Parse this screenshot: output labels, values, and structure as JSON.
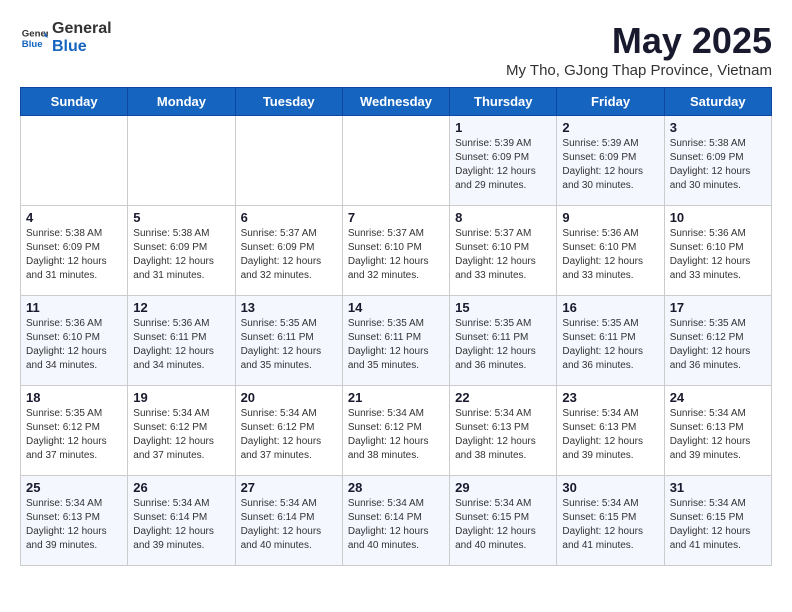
{
  "header": {
    "logo_general": "General",
    "logo_blue": "Blue",
    "title": "May 2025",
    "subtitle": "My Tho, GJong Thap Province, Vietnam"
  },
  "weekdays": [
    "Sunday",
    "Monday",
    "Tuesday",
    "Wednesday",
    "Thursday",
    "Friday",
    "Saturday"
  ],
  "weeks": [
    [
      {
        "day": "",
        "info": ""
      },
      {
        "day": "",
        "info": ""
      },
      {
        "day": "",
        "info": ""
      },
      {
        "day": "",
        "info": ""
      },
      {
        "day": "1",
        "info": "Sunrise: 5:39 AM\nSunset: 6:09 PM\nDaylight: 12 hours and 29 minutes."
      },
      {
        "day": "2",
        "info": "Sunrise: 5:39 AM\nSunset: 6:09 PM\nDaylight: 12 hours and 30 minutes."
      },
      {
        "day": "3",
        "info": "Sunrise: 5:38 AM\nSunset: 6:09 PM\nDaylight: 12 hours and 30 minutes."
      }
    ],
    [
      {
        "day": "4",
        "info": "Sunrise: 5:38 AM\nSunset: 6:09 PM\nDaylight: 12 hours and 31 minutes."
      },
      {
        "day": "5",
        "info": "Sunrise: 5:38 AM\nSunset: 6:09 PM\nDaylight: 12 hours and 31 minutes."
      },
      {
        "day": "6",
        "info": "Sunrise: 5:37 AM\nSunset: 6:09 PM\nDaylight: 12 hours and 32 minutes."
      },
      {
        "day": "7",
        "info": "Sunrise: 5:37 AM\nSunset: 6:10 PM\nDaylight: 12 hours and 32 minutes."
      },
      {
        "day": "8",
        "info": "Sunrise: 5:37 AM\nSunset: 6:10 PM\nDaylight: 12 hours and 33 minutes."
      },
      {
        "day": "9",
        "info": "Sunrise: 5:36 AM\nSunset: 6:10 PM\nDaylight: 12 hours and 33 minutes."
      },
      {
        "day": "10",
        "info": "Sunrise: 5:36 AM\nSunset: 6:10 PM\nDaylight: 12 hours and 33 minutes."
      }
    ],
    [
      {
        "day": "11",
        "info": "Sunrise: 5:36 AM\nSunset: 6:10 PM\nDaylight: 12 hours and 34 minutes."
      },
      {
        "day": "12",
        "info": "Sunrise: 5:36 AM\nSunset: 6:11 PM\nDaylight: 12 hours and 34 minutes."
      },
      {
        "day": "13",
        "info": "Sunrise: 5:35 AM\nSunset: 6:11 PM\nDaylight: 12 hours and 35 minutes."
      },
      {
        "day": "14",
        "info": "Sunrise: 5:35 AM\nSunset: 6:11 PM\nDaylight: 12 hours and 35 minutes."
      },
      {
        "day": "15",
        "info": "Sunrise: 5:35 AM\nSunset: 6:11 PM\nDaylight: 12 hours and 36 minutes."
      },
      {
        "day": "16",
        "info": "Sunrise: 5:35 AM\nSunset: 6:11 PM\nDaylight: 12 hours and 36 minutes."
      },
      {
        "day": "17",
        "info": "Sunrise: 5:35 AM\nSunset: 6:12 PM\nDaylight: 12 hours and 36 minutes."
      }
    ],
    [
      {
        "day": "18",
        "info": "Sunrise: 5:35 AM\nSunset: 6:12 PM\nDaylight: 12 hours and 37 minutes."
      },
      {
        "day": "19",
        "info": "Sunrise: 5:34 AM\nSunset: 6:12 PM\nDaylight: 12 hours and 37 minutes."
      },
      {
        "day": "20",
        "info": "Sunrise: 5:34 AM\nSunset: 6:12 PM\nDaylight: 12 hours and 37 minutes."
      },
      {
        "day": "21",
        "info": "Sunrise: 5:34 AM\nSunset: 6:12 PM\nDaylight: 12 hours and 38 minutes."
      },
      {
        "day": "22",
        "info": "Sunrise: 5:34 AM\nSunset: 6:13 PM\nDaylight: 12 hours and 38 minutes."
      },
      {
        "day": "23",
        "info": "Sunrise: 5:34 AM\nSunset: 6:13 PM\nDaylight: 12 hours and 39 minutes."
      },
      {
        "day": "24",
        "info": "Sunrise: 5:34 AM\nSunset: 6:13 PM\nDaylight: 12 hours and 39 minutes."
      }
    ],
    [
      {
        "day": "25",
        "info": "Sunrise: 5:34 AM\nSunset: 6:13 PM\nDaylight: 12 hours and 39 minutes."
      },
      {
        "day": "26",
        "info": "Sunrise: 5:34 AM\nSunset: 6:14 PM\nDaylight: 12 hours and 39 minutes."
      },
      {
        "day": "27",
        "info": "Sunrise: 5:34 AM\nSunset: 6:14 PM\nDaylight: 12 hours and 40 minutes."
      },
      {
        "day": "28",
        "info": "Sunrise: 5:34 AM\nSunset: 6:14 PM\nDaylight: 12 hours and 40 minutes."
      },
      {
        "day": "29",
        "info": "Sunrise: 5:34 AM\nSunset: 6:15 PM\nDaylight: 12 hours and 40 minutes."
      },
      {
        "day": "30",
        "info": "Sunrise: 5:34 AM\nSunset: 6:15 PM\nDaylight: 12 hours and 41 minutes."
      },
      {
        "day": "31",
        "info": "Sunrise: 5:34 AM\nSunset: 6:15 PM\nDaylight: 12 hours and 41 minutes."
      }
    ]
  ]
}
